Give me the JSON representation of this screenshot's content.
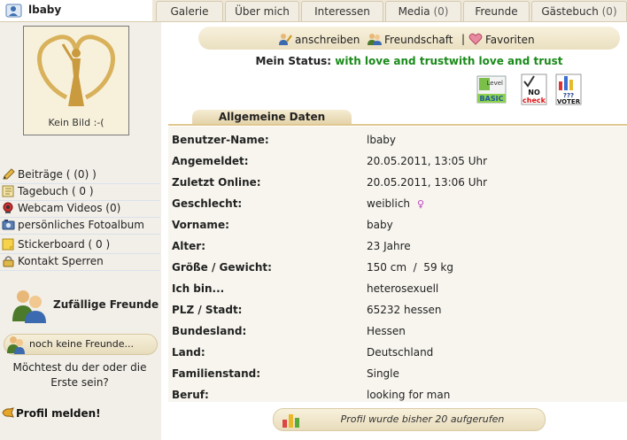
{
  "user": {
    "name": "lbaby"
  },
  "tabs": [
    {
      "label": "Galerie",
      "count": ""
    },
    {
      "label": "Über mich",
      "count": ""
    },
    {
      "label": "Interessen",
      "count": ""
    },
    {
      "label": "Media",
      "count": "(0)"
    },
    {
      "label": "Freunde",
      "count": ""
    },
    {
      "label": "Gästebuch",
      "count": "(0)"
    }
  ],
  "avatar": {
    "caption": "Kein Bild :-("
  },
  "left_menu": [
    {
      "label": "Beiträge ( (0) )",
      "icon": "pencil-icon"
    },
    {
      "label": "Tagebuch ( 0 )",
      "icon": "diary-icon"
    },
    {
      "label": "Webcam Videos (0)",
      "icon": "webcam-icon"
    },
    {
      "label": "persönliches Fotoalbum",
      "icon": "camera-icon"
    },
    {
      "label": "Stickerboard ( 0 )",
      "icon": "sticker-icon"
    },
    {
      "label": "Kontakt Sperren",
      "icon": "lock-icon"
    }
  ],
  "friends": {
    "title": "Zufällige Freunde",
    "none_label": "noch keine Freunde...",
    "ask_line1": "Möchtest du der oder die",
    "ask_line2": "Erste sein?"
  },
  "report": {
    "label": "Profil melden!"
  },
  "actions": {
    "write": "anschreiben",
    "friendship": "Freundschaft",
    "separator": "|",
    "favorites": "Favoriten"
  },
  "status": {
    "label": "Mein Status:",
    "value": "with love and trustwith love and trust"
  },
  "badges": {
    "basic_top": "Level",
    "basic_main": "BASIC",
    "nocheck_top": "NO",
    "nocheck_bottom": "check",
    "voter_top": "???",
    "voter_bottom": "VOTER"
  },
  "section_title": "Allgemeine Daten",
  "profile": [
    {
      "key": "Benutzer-Name:",
      "value": "lbaby"
    },
    {
      "key": "Angemeldet:",
      "value": "20.05.2011, 13:05 Uhr"
    },
    {
      "key": "Zuletzt Online:",
      "value": "20.05.2011, 13:06 Uhr"
    },
    {
      "key": "Geschlecht:",
      "value": "weiblich",
      "symbol": "♀"
    },
    {
      "key": "Vorname:",
      "value": "baby"
    },
    {
      "key": "Alter:",
      "value": "23 Jahre"
    },
    {
      "key": "Größe / Gewicht:",
      "value": "150 cm  /  59 kg"
    },
    {
      "key": "Ich bin...",
      "value": "heterosexuell"
    },
    {
      "key": "PLZ / Stadt:",
      "value": "65232 hessen"
    },
    {
      "key": "Bundesland:",
      "value": "Hessen"
    },
    {
      "key": "Land:",
      "value": "Deutschland"
    },
    {
      "key": "Familienstand:",
      "value": "Single"
    },
    {
      "key": "Beruf:",
      "value": "looking for man"
    }
  ],
  "views": {
    "label": "Profil wurde bisher 20 aufgerufen"
  },
  "colors": {
    "status_green": "#1a8a1a",
    "accent_gold": "#e0c890",
    "female_pink": "#c040c0"
  }
}
